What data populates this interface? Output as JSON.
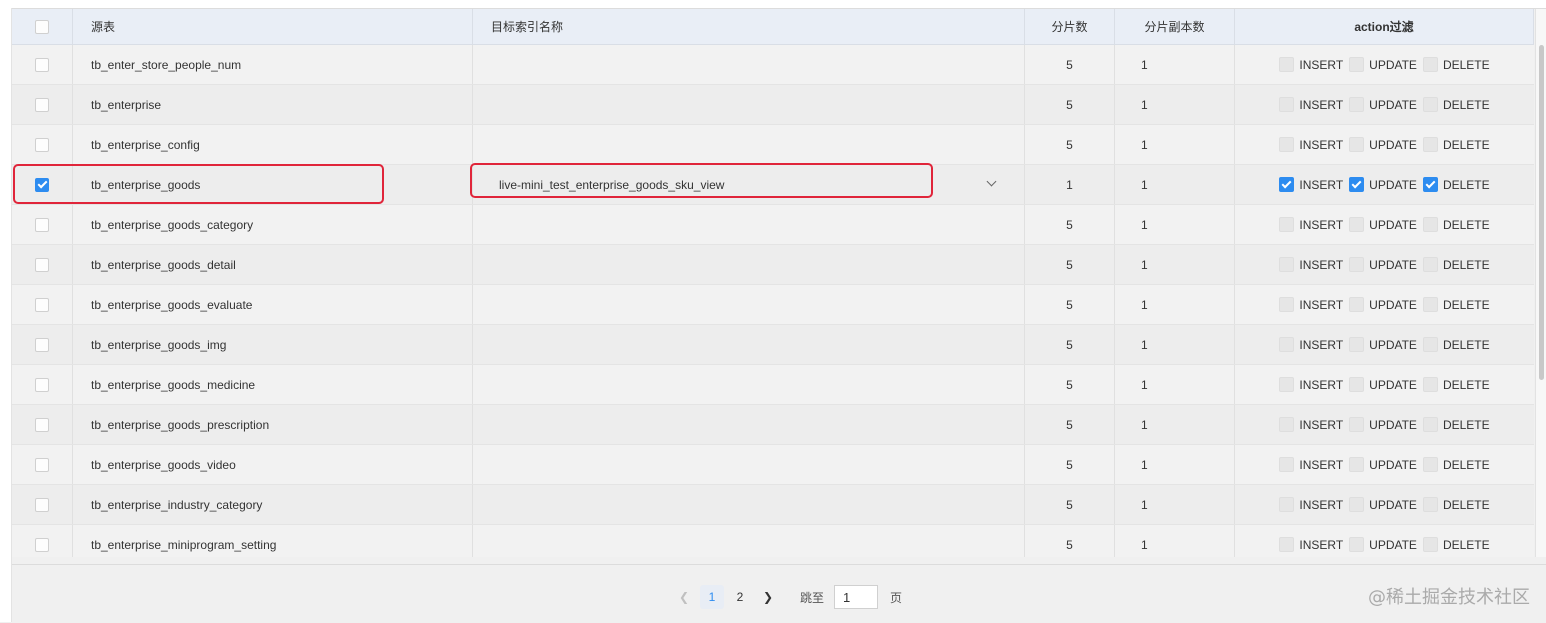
{
  "columns": {
    "source": "源表",
    "target_index": "目标索引名称",
    "shards": "分片数",
    "replicas": "分片副本数",
    "action_filter": "action过滤"
  },
  "action_labels": {
    "insert": "INSERT",
    "update": "UPDATE",
    "delete": "DELETE"
  },
  "rows": [
    {
      "source": "tb_enter_store_people_num",
      "target": "",
      "shards": "5",
      "replicas": "1",
      "checked": false,
      "insert": false,
      "update": false,
      "delete": false
    },
    {
      "source": "tb_enterprise",
      "target": "",
      "shards": "5",
      "replicas": "1",
      "checked": false,
      "insert": false,
      "update": false,
      "delete": false
    },
    {
      "source": "tb_enterprise_config",
      "target": "",
      "shards": "5",
      "replicas": "1",
      "checked": false,
      "insert": false,
      "update": false,
      "delete": false
    },
    {
      "source": "tb_enterprise_goods",
      "target": "live-mini_test_enterprise_goods_sku_view",
      "shards": "1",
      "replicas": "1",
      "checked": true,
      "insert": true,
      "update": true,
      "delete": true
    },
    {
      "source": "tb_enterprise_goods_category",
      "target": "",
      "shards": "5",
      "replicas": "1",
      "checked": false,
      "insert": false,
      "update": false,
      "delete": false
    },
    {
      "source": "tb_enterprise_goods_detail",
      "target": "",
      "shards": "5",
      "replicas": "1",
      "checked": false,
      "insert": false,
      "update": false,
      "delete": false
    },
    {
      "source": "tb_enterprise_goods_evaluate",
      "target": "",
      "shards": "5",
      "replicas": "1",
      "checked": false,
      "insert": false,
      "update": false,
      "delete": false
    },
    {
      "source": "tb_enterprise_goods_img",
      "target": "",
      "shards": "5",
      "replicas": "1",
      "checked": false,
      "insert": false,
      "update": false,
      "delete": false
    },
    {
      "source": "tb_enterprise_goods_medicine",
      "target": "",
      "shards": "5",
      "replicas": "1",
      "checked": false,
      "insert": false,
      "update": false,
      "delete": false
    },
    {
      "source": "tb_enterprise_goods_prescription",
      "target": "",
      "shards": "5",
      "replicas": "1",
      "checked": false,
      "insert": false,
      "update": false,
      "delete": false
    },
    {
      "source": "tb_enterprise_goods_video",
      "target": "",
      "shards": "5",
      "replicas": "1",
      "checked": false,
      "insert": false,
      "update": false,
      "delete": false
    },
    {
      "source": "tb_enterprise_industry_category",
      "target": "",
      "shards": "5",
      "replicas": "1",
      "checked": false,
      "insert": false,
      "update": false,
      "delete": false
    },
    {
      "source": "tb_enterprise_miniprogram_setting",
      "target": "",
      "shards": "5",
      "replicas": "1",
      "checked": false,
      "insert": false,
      "update": false,
      "delete": false
    }
  ],
  "pagination": {
    "current_page": "1",
    "next_page": "2",
    "goto_label": "跳至",
    "goto_value": "1",
    "goto_suffix": "页",
    "prev_icon": "chevron-left-icon",
    "next_icon": "chevron-right-icon"
  },
  "watermark": "@稀土掘金技术社区",
  "colors": {
    "accent": "#2d8cf0",
    "highlight_box": "#e0253a",
    "header_bg": "#e9eef6"
  }
}
